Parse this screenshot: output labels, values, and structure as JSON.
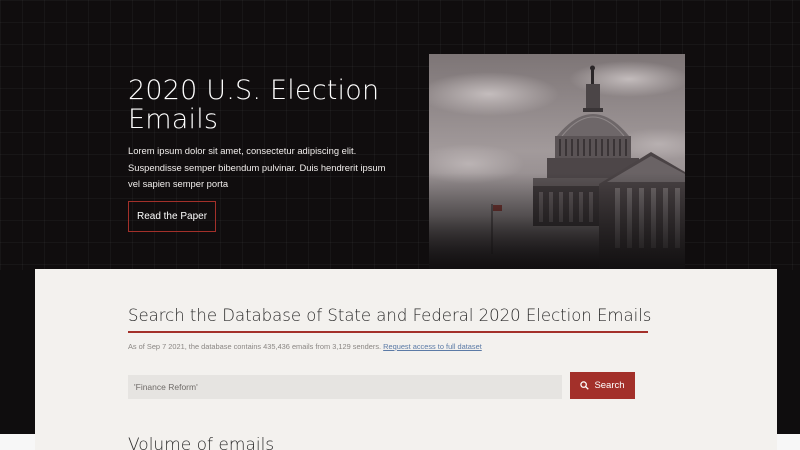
{
  "hero": {
    "title": "2020 U.S. Election Emails",
    "description": "Lorem ipsum dolor sit amet, consectetur adipiscing elit. Suspendisse semper bibendum pulvinar. Duis hendrerit ipsum vel sapien semper porta",
    "button_label": "Read the Paper",
    "image_icon": "capitol-building-photo"
  },
  "search": {
    "title": "Search the Database of State and Federal 2020 Election Emails",
    "meta_text": "As of Sep 7 2021, the database contains 435,436 emails from 3,129 senders.",
    "request_link": "Request access to full dataset",
    "input_value": "'Finance Reform'",
    "button_label": "Search",
    "button_icon": "search-icon"
  },
  "volume": {
    "title": "Volume of emails"
  },
  "colors": {
    "accent": "#a3302a",
    "hero_background": "#100d0e",
    "panel_background": "#f3f1ee",
    "link": "#5b7aa6"
  }
}
